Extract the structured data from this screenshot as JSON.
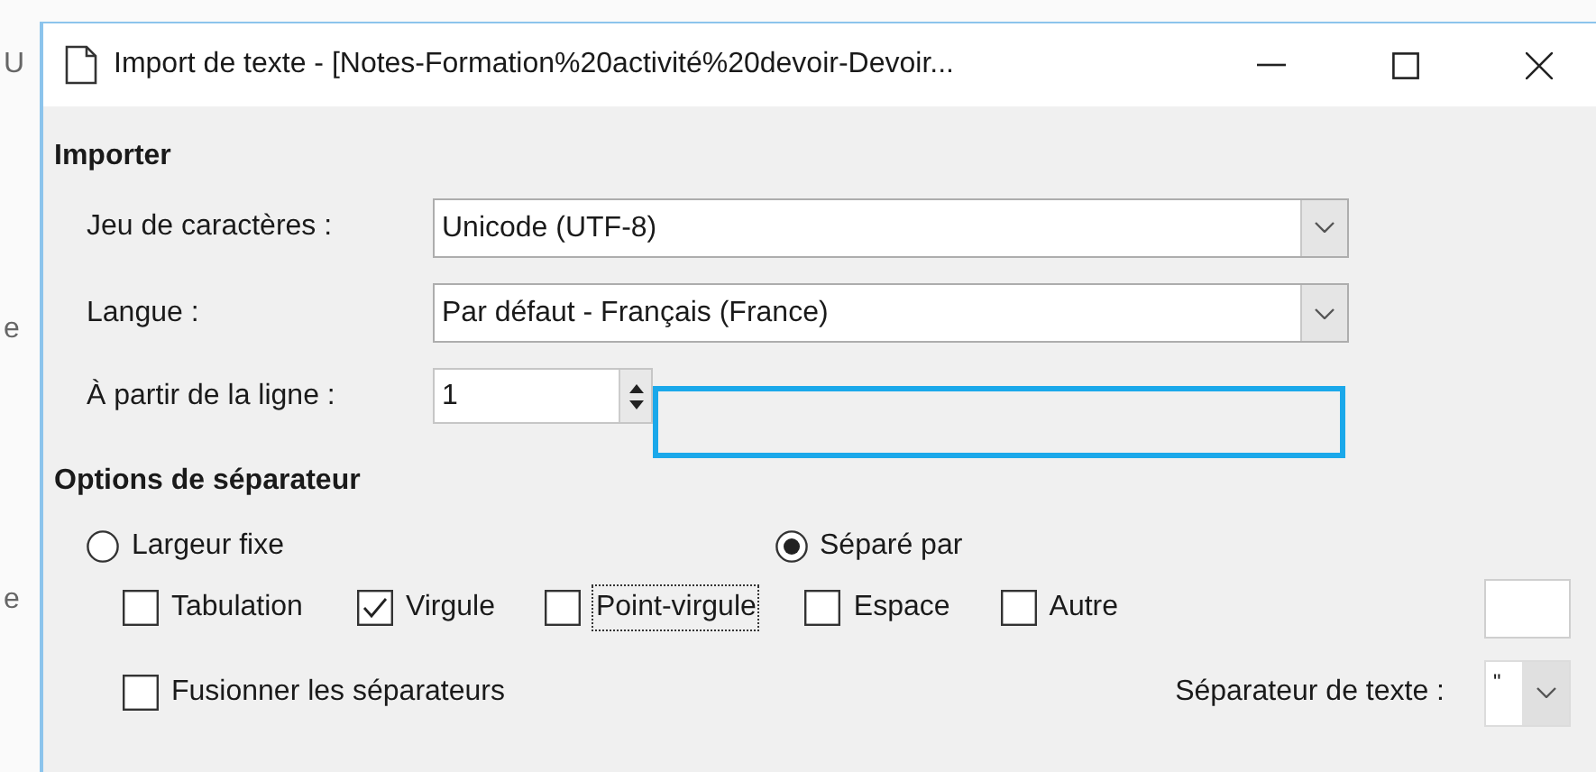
{
  "background_window": {
    "fragments": [
      "U",
      "e",
      "e"
    ]
  },
  "window": {
    "title": "Import de texte - [Notes-Formation%20activité%20devoir-Devoir..."
  },
  "import_section": {
    "heading": "Importer",
    "fields": [
      {
        "kind": "combo",
        "label": "Jeu de caractères :",
        "value": "Unicode (UTF-8)"
      },
      {
        "kind": "combo",
        "label": "Langue :",
        "value": "Par défaut - Français (France)"
      },
      {
        "kind": "spin",
        "label": "À partir de la ligne :",
        "value": "1"
      }
    ]
  },
  "separator_section": {
    "heading": "Options de séparateur",
    "modes": [
      {
        "label": "Largeur fixe",
        "selected": false
      },
      {
        "label": "Séparé par",
        "selected": true
      }
    ],
    "separators": [
      {
        "label": "Tabulation",
        "checked": false,
        "focused": false
      },
      {
        "label": "Virgule",
        "checked": true,
        "focused": false
      },
      {
        "label": "Point-virgule",
        "checked": false,
        "focused": true
      },
      {
        "label": "Espace",
        "checked": false,
        "focused": false
      },
      {
        "label": "Autre",
        "checked": false,
        "focused": false
      }
    ],
    "merge": {
      "label": "Fusionner les séparateurs",
      "checked": false
    },
    "text_separator": {
      "label": "Séparateur de texte :",
      "value": "\""
    }
  }
}
